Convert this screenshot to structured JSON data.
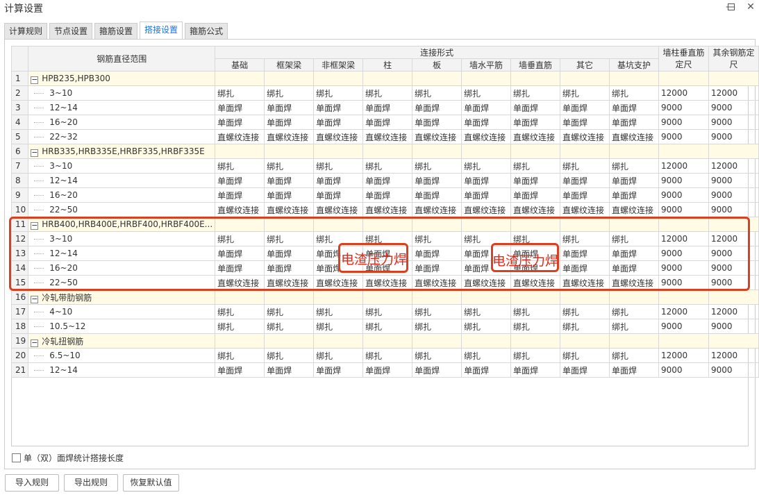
{
  "window": {
    "title": "计算设置",
    "minimize_icon": "minimize-icon",
    "maximize_icon": "maximize-icon",
    "close_icon": "close-icon"
  },
  "tabs": [
    {
      "label": "计算规则"
    },
    {
      "label": "节点设置"
    },
    {
      "label": "箍筋设置"
    },
    {
      "label": "搭接设置",
      "active": true
    },
    {
      "label": "箍筋公式"
    }
  ],
  "table": {
    "header": {
      "range": "钢筋直径范围",
      "connection": "连接形式",
      "columns": [
        "基础",
        "框架梁",
        "非框架梁",
        "柱",
        "板",
        "墙水平筋",
        "墙垂直筋",
        "其它",
        "基坑支护"
      ],
      "wall_col": "墙柱垂直筋定尺",
      "other_col": "其余钢筋定尺"
    },
    "rows": [
      {
        "n": "1",
        "group": true,
        "label": "HPB235,HPB300"
      },
      {
        "n": "2",
        "label": "3~10",
        "conn": "绑扎",
        "l1": "12000",
        "l2": "12000"
      },
      {
        "n": "3",
        "label": "12~14",
        "conn": "单面焊",
        "l1": "9000",
        "l2": "9000"
      },
      {
        "n": "4",
        "label": "16~20",
        "conn": "单面焊",
        "l1": "9000",
        "l2": "9000"
      },
      {
        "n": "5",
        "label": "22~32",
        "conn": "直螺纹连接",
        "l1": "9000",
        "l2": "9000"
      },
      {
        "n": "6",
        "group": true,
        "label": "HRB335,HRB335E,HRBF335,HRBF335E"
      },
      {
        "n": "7",
        "label": "3~10",
        "conn": "绑扎",
        "l1": "12000",
        "l2": "12000"
      },
      {
        "n": "8",
        "label": "12~14",
        "conn": "单面焊",
        "l1": "9000",
        "l2": "9000"
      },
      {
        "n": "9",
        "label": "16~20",
        "conn": "单面焊",
        "l1": "9000",
        "l2": "9000"
      },
      {
        "n": "10",
        "label": "22~50",
        "conn": "直螺纹连接",
        "l1": "9000",
        "l2": "9000"
      },
      {
        "n": "11",
        "group": true,
        "label": "HRB400,HRB400E,HRBF400,HRBF400E..."
      },
      {
        "n": "12",
        "label": "3~10",
        "conn": "绑扎",
        "l1": "12000",
        "l2": "12000"
      },
      {
        "n": "13",
        "label": "12~14",
        "conn": "单面焊",
        "l1": "9000",
        "l2": "9000"
      },
      {
        "n": "14",
        "label": "16~20",
        "conn": "单面焊",
        "l1": "9000",
        "l2": "9000"
      },
      {
        "n": "15",
        "label": "22~50",
        "conn": "直螺纹连接",
        "l1": "9000",
        "l2": "9000"
      },
      {
        "n": "16",
        "group": true,
        "label": "冷轧带肋钢筋"
      },
      {
        "n": "17",
        "label": "4~10",
        "conn": "绑扎",
        "l1": "12000",
        "l2": "12000"
      },
      {
        "n": "18",
        "label": "10.5~12",
        "conn": "绑扎",
        "l1": "9000",
        "l2": "9000"
      },
      {
        "n": "19",
        "group": true,
        "label": "冷轧扭钢筋"
      },
      {
        "n": "20",
        "label": "6.5~10",
        "conn": "绑扎",
        "l1": "12000",
        "l2": "12000"
      },
      {
        "n": "21",
        "label": "12~14",
        "conn": "单面焊",
        "l1": "9000",
        "l2": "9000"
      }
    ]
  },
  "annotations": {
    "note1": "电渣压力焊",
    "note2": "电渣压力焊",
    "color": "#d9401f"
  },
  "checkbox": {
    "label": "单（双）面焊统计搭接长度",
    "checked": false
  },
  "buttons": {
    "import": "导入规则",
    "export": "导出规则",
    "reset": "恢复默认值"
  }
}
